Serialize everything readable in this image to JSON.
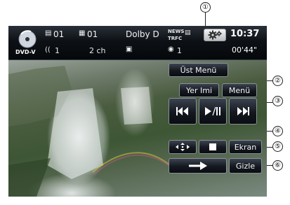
{
  "status_bar": {
    "source_label": "DVD-V",
    "title_number": "01",
    "chapter_number": "01",
    "audio_format": "Dolby D",
    "audio_stream": "1",
    "channels": "2 ch",
    "angle": "1",
    "news_label": "NEWS",
    "trfc_label": "TRFC",
    "clock": "10:37",
    "elapsed_time": "00'44\""
  },
  "controls": {
    "top_menu_label": "Üst Menü",
    "bookmark_label": "Yer Imi",
    "menu_label": "Menü",
    "screen_label": "Ekran",
    "hide_label": "Gizle"
  },
  "callouts": [
    "①",
    "②",
    "③",
    "④",
    "⑤",
    "⑥",
    "⑦",
    "⑧",
    "⑨"
  ],
  "icons": {
    "disc": "disc-icon",
    "settings": "gear-icon",
    "prev": "skip-previous-icon",
    "play_pause": "play-pause-icon",
    "next": "skip-next-icon",
    "cursor": "four-way-arrow-icon",
    "stop": "stop-icon",
    "arrow": "right-arrow-icon"
  }
}
